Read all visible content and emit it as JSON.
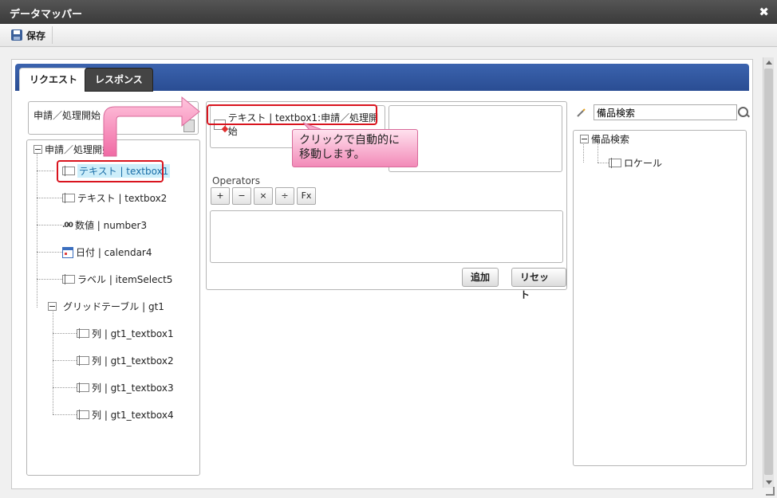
{
  "window": {
    "title": "データマッパー"
  },
  "toolbar": {
    "save_label": "保存"
  },
  "tabs": [
    {
      "label": "リクエスト",
      "active": true
    },
    {
      "label": "レスポンス",
      "active": false
    }
  ],
  "source": {
    "header_label": "申請／処理開始",
    "tree": {
      "root": "申請／処理開始",
      "items": [
        {
          "label": "テキスト | textbox1",
          "icon": "textfield-icon",
          "selected": true
        },
        {
          "label": "テキスト | textbox2",
          "icon": "textfield-icon"
        },
        {
          "label": "数値 | number3",
          "icon": "number-icon"
        },
        {
          "label": "日付 | calendar4",
          "icon": "calendar-icon"
        },
        {
          "label": "ラベル | itemSelect5",
          "icon": "textfield-icon"
        },
        {
          "label": "グリッドテーブル | gt1",
          "icon": "minus-icon"
        }
      ],
      "grid_children": [
        "列 | gt1_textbox1",
        "列 | gt1_textbox2",
        "列 | gt1_textbox3",
        "列 | gt1_textbox4"
      ]
    }
  },
  "mapping": {
    "target_label": "テキスト | textbox1:申請／処理開始",
    "operators_label": "Operators",
    "operators": [
      "+",
      "−",
      "×",
      "÷",
      "Fx"
    ],
    "add_label": "追加",
    "reset_label": "リセット"
  },
  "tooltip": {
    "line1": "クリックで自動的に",
    "line2": "移動します。"
  },
  "right": {
    "search_value": "備品検索",
    "tree_root": "備品検索",
    "tree_child": "ロケール"
  },
  "colors": {
    "tab_bar": "#3b63ae",
    "highlight_red": "#d9141e",
    "tooltip_pink": "#f28ab8",
    "selected_bg": "#cdeefa"
  }
}
